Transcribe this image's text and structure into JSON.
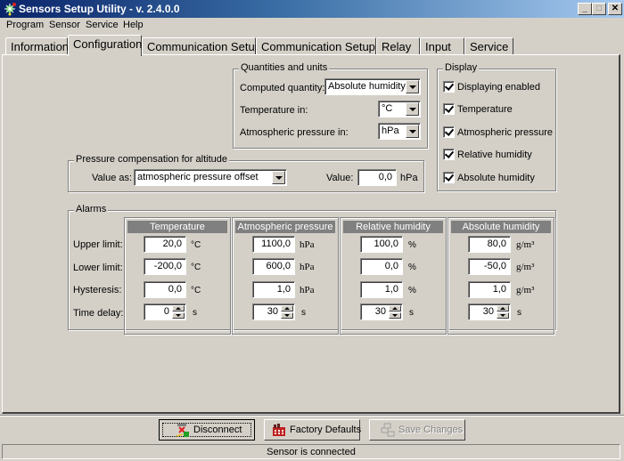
{
  "window": {
    "title": "Sensors Setup Utility - v. 2.4.0.0",
    "controls": {
      "minimize": "_",
      "maximize": "□",
      "close": "✕"
    }
  },
  "menu": [
    "Program",
    "Sensor",
    "Service",
    "Help"
  ],
  "tabs": [
    {
      "label": "Information",
      "active": false
    },
    {
      "label": "Configuration",
      "active": true
    },
    {
      "label": "Communication Setup",
      "active": false
    },
    {
      "label": "Communication Setup I",
      "active": false
    },
    {
      "label": "Relay",
      "active": false
    },
    {
      "label": "Input",
      "active": false
    },
    {
      "label": "Service",
      "active": false
    }
  ],
  "quantities": {
    "group_label": "Quantities and units",
    "computed_quantity_label": "Computed quantity:",
    "computed_quantity_value": "Absolute humidity",
    "temperature_label": "Temperature in:",
    "temperature_value": "°C",
    "pressure_label": "Atmospheric pressure in:",
    "pressure_value": "hPa"
  },
  "display": {
    "group_label": "Display",
    "items": [
      {
        "label": "Displaying enabled",
        "checked": true
      },
      {
        "label": "Temperature",
        "checked": true
      },
      {
        "label": "Atmospheric pressure",
        "checked": true
      },
      {
        "label": "Relative humidity",
        "checked": true
      },
      {
        "label": "Absolute humidity",
        "checked": true
      }
    ]
  },
  "pressure_comp": {
    "group_label": "Pressure compensation for altitude",
    "value_as_label": "Value as:",
    "value_as": "atmospheric pressure offset",
    "value_label": "Value:",
    "value": "0,0",
    "unit": "hPa"
  },
  "alarms": {
    "group_label": "Alarms",
    "row_labels": [
      "Upper limit:",
      "Lower limit:",
      "Hysteresis:",
      "Time delay:"
    ],
    "columns": [
      {
        "title": "Temperature",
        "upper": "20,0",
        "lower": "-200,0",
        "hysteresis": "0,0",
        "delay": "0",
        "unit": "°C",
        "delay_unit": "s"
      },
      {
        "title": "Atmospheric pressure",
        "upper": "1100,0",
        "lower": "600,0",
        "hysteresis": "1,0",
        "delay": "30",
        "unit": "hPa",
        "delay_unit": "s"
      },
      {
        "title": "Relative humidity",
        "upper": "100,0",
        "lower": "0,0",
        "hysteresis": "1,0",
        "delay": "30",
        "unit": "%",
        "delay_unit": "s"
      },
      {
        "title": "Absolute humidity",
        "upper": "80,0",
        "lower": "-50,0",
        "hysteresis": "1,0",
        "delay": "30",
        "unit": "g/m³",
        "delay_unit": "s"
      }
    ]
  },
  "buttons": {
    "disconnect": "Disconnect",
    "factory_defaults": "Factory Defaults",
    "save_changes": "Save Changes"
  },
  "status": "Sensor is connected"
}
